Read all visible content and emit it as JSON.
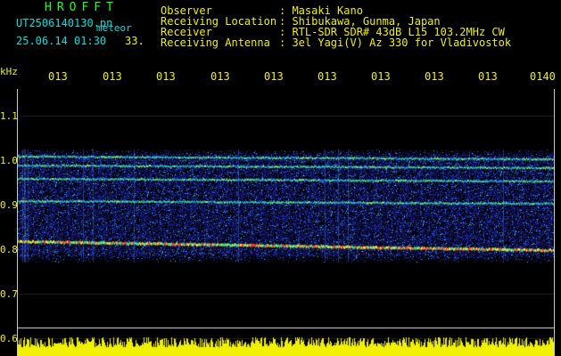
{
  "header": {
    "brand": "HROFFT",
    "file": "UT2506140130.pn",
    "label": "meteor",
    "date_time": "25.06.14 01:30",
    "count": "33."
  },
  "meta": [
    {
      "key": "Observer",
      "value": ": Masaki Kano"
    },
    {
      "key": "Receiving Location",
      "value": ": Shibukawa, Gunma, Japan"
    },
    {
      "key": "Receiver",
      "value": ": RTL-SDR SDR# 43dB L15 103.2MHz CW"
    },
    {
      "key": "Receiving Antenna",
      "value": ": 3el Yagi(V) Az 330 for Vladivostok"
    }
  ],
  "spectrogram": {
    "y_unit": "kHz",
    "y_ticks": [
      "1.1",
      "1.0",
      "0.9",
      "0.8",
      "0.7",
      "0.6"
    ],
    "x_ticks": [
      "013",
      "013",
      "013",
      "013",
      "013",
      "013",
      "013",
      "013",
      "013",
      "0140"
    ],
    "traces_khz": [
      0.82,
      0.91,
      0.96,
      0.99,
      1.01
    ],
    "colors": {
      "text_yellow": "#f0f000",
      "text_cyan": "#00e0e0",
      "title_green": "#20ff20",
      "background": "#000000",
      "signal_blue": "#1a1aa0"
    }
  }
}
